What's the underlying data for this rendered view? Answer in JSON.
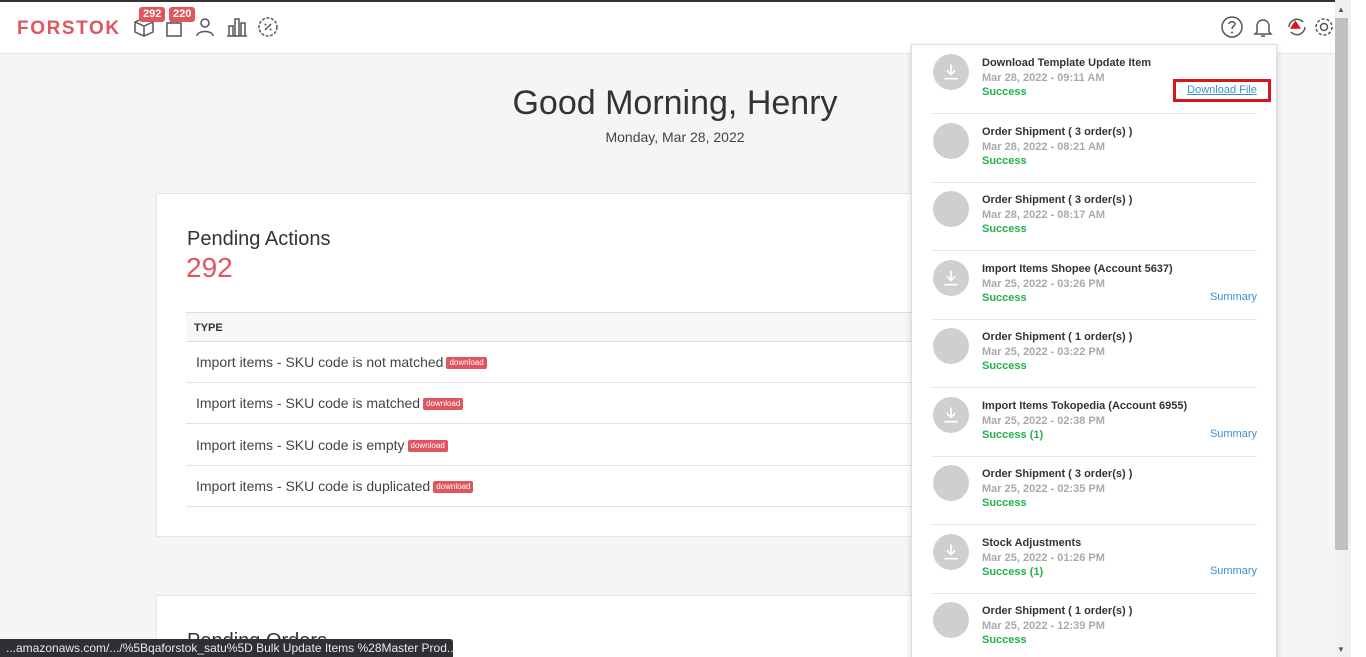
{
  "app": {
    "logo": "FORSTOK"
  },
  "nav": {
    "badges": {
      "products": "292",
      "orders": "220"
    }
  },
  "greeting": {
    "title": "Good Morning, Henry",
    "date": "Monday, Mar 28, 2022"
  },
  "pending_actions": {
    "title": "Pending Actions",
    "count": "292",
    "column_header": "TYPE",
    "badge_label": "download",
    "rows": [
      "Import items - SKU code is not matched",
      "Import items - SKU code is matched",
      "Import items - SKU code is empty",
      "Import items - SKU code is duplicated"
    ]
  },
  "pending_orders": {
    "title": "Pending Orders"
  },
  "notifications": [
    {
      "title": "Download Template Update Item",
      "time": "Mar 28, 2022 - 09:11 AM",
      "status": "Success",
      "action": "Download File",
      "icon": "download-icon"
    },
    {
      "title": "Order Shipment ( 3 order(s) )",
      "time": "Mar 28, 2022 - 08:21 AM",
      "status": "Success",
      "action": "",
      "icon": ""
    },
    {
      "title": "Order Shipment ( 3 order(s) )",
      "time": "Mar 28, 2022 - 08:17 AM",
      "status": "Success",
      "action": "",
      "icon": ""
    },
    {
      "title": "Import Items Shopee (Account 5637)",
      "time": "Mar 25, 2022 - 03:26 PM",
      "status": "Success",
      "action": "Summary",
      "icon": "download-icon"
    },
    {
      "title": "Order Shipment ( 1 order(s) )",
      "time": "Mar 25, 2022 - 03:22 PM",
      "status": "Success",
      "action": "",
      "icon": ""
    },
    {
      "title": "Import Items Tokopedia (Account 6955)",
      "time": "Mar 25, 2022 - 02:38 PM",
      "status": "Success (1)",
      "action": "Summary",
      "icon": "download-icon"
    },
    {
      "title": "Order Shipment ( 3 order(s) )",
      "time": "Mar 25, 2022 - 02:35 PM",
      "status": "Success",
      "action": "",
      "icon": ""
    },
    {
      "title": "Stock Adjustments",
      "time": "Mar 25, 2022 - 01:26 PM",
      "status": "Success (1)",
      "action": "Summary",
      "icon": "download-icon"
    },
    {
      "title": "Order Shipment ( 1 order(s) )",
      "time": "Mar 25, 2022 - 12:39 PM",
      "status": "Success",
      "action": "",
      "icon": ""
    }
  ],
  "statusbar": {
    "url": "...amazonaws.com/.../%5Bqaforstok_satu%5D Bulk Update Items %28Master Prod..."
  },
  "colors": {
    "brand": "#e0555e",
    "success": "#21b14a",
    "link": "#3a8fd0",
    "highlight": "#d8141f"
  }
}
